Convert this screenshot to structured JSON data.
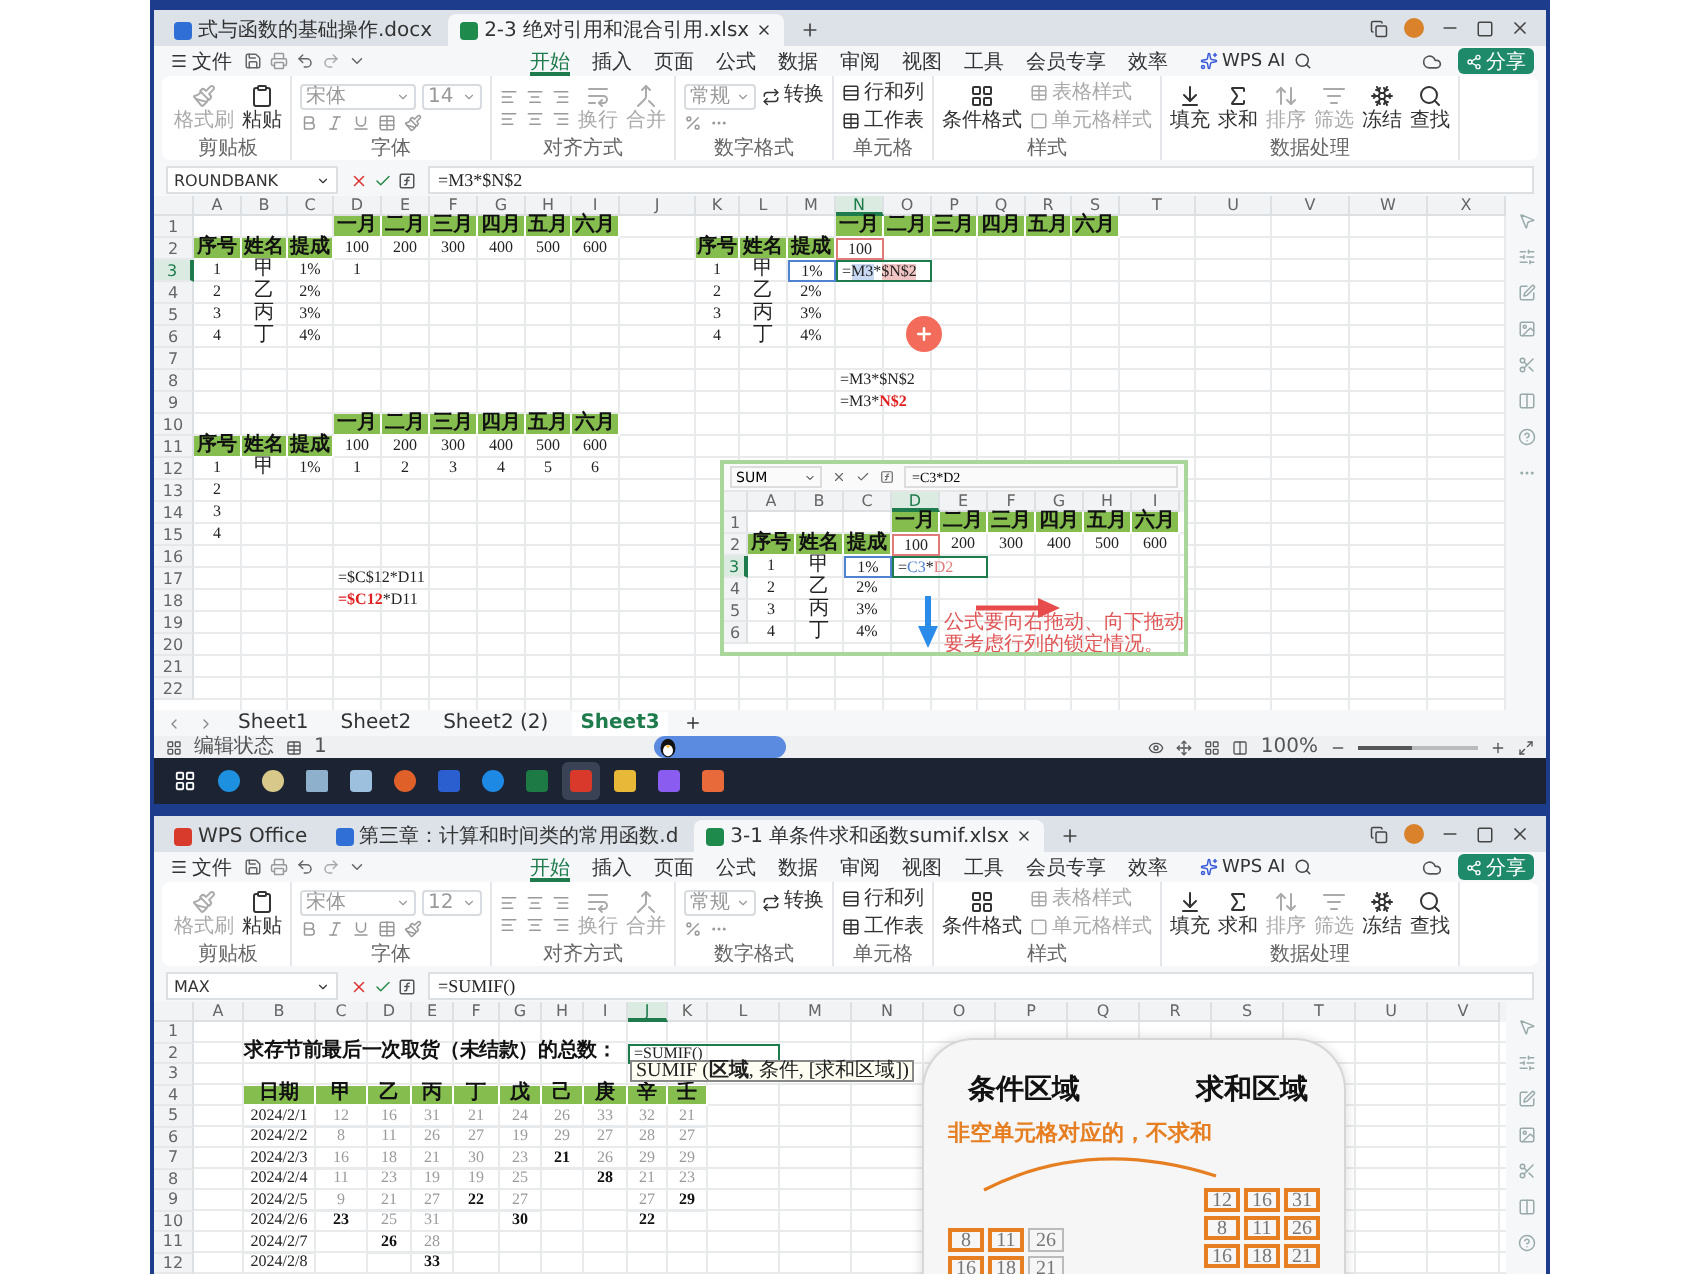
{
  "top": {
    "tabs": [
      {
        "label": "式与函数的基础操作.docx",
        "kind": "doc",
        "selected": false
      },
      {
        "label": "2-3 绝对引用和混合引用.xlsx",
        "kind": "sheet",
        "selected": true
      }
    ],
    "menu": {
      "file": "文件",
      "items": [
        {
          "label": "开始",
          "selected": true
        },
        {
          "label": "插入",
          "selected": false
        },
        {
          "label": "页面",
          "selected": false
        },
        {
          "label": "公式",
          "selected": false
        },
        {
          "label": "数据",
          "selected": false
        },
        {
          "label": "审阅",
          "selected": false
        },
        {
          "label": "视图",
          "selected": false
        },
        {
          "label": "工具",
          "selected": false
        },
        {
          "label": "会员专享",
          "selected": false
        },
        {
          "label": "效率",
          "selected": false
        }
      ],
      "ai": "WPS AI",
      "share": "分享"
    },
    "ribbon": {
      "groups": [
        {
          "kind": "clipboard",
          "label": "剪贴板",
          "items": [
            {
              "label": "格式刷",
              "disabled": true
            },
            {
              "label": "粘贴",
              "disabled": false
            }
          ]
        },
        {
          "kind": "font",
          "label": "字体",
          "font": "宋体",
          "size": "14"
        },
        {
          "kind": "align",
          "label": "对齐方式",
          "items": [
            {
              "label": "换行",
              "disabled": true
            },
            {
              "label": "合并",
              "disabled": true
            }
          ]
        },
        {
          "kind": "number",
          "label": "数字格式",
          "format": "常规",
          "items": [
            {
              "label": "转换",
              "disabled": false
            }
          ]
        },
        {
          "kind": "cells",
          "label": "单元格",
          "items": [
            {
              "label": "行和列",
              "disabled": false
            },
            {
              "label": "工作表",
              "disabled": false
            }
          ]
        },
        {
          "kind": "style",
          "label": "样式",
          "items": [
            {
              "label": "条件格式",
              "disabled": false
            },
            {
              "label": "表格样式",
              "disabled": true
            },
            {
              "label": "单元格样式",
              "disabled": true
            }
          ]
        },
        {
          "kind": "data",
          "label": "数据处理",
          "items": [
            {
              "label": "填充",
              "disabled": false
            },
            {
              "label": "求和",
              "disabled": false
            },
            {
              "label": "排序",
              "disabled": true
            },
            {
              "label": "筛选",
              "disabled": true
            },
            {
              "label": "冻结",
              "disabled": false
            },
            {
              "label": "查找",
              "disabled": false
            }
          ]
        }
      ]
    },
    "sheet": {
      "name_box": "ROUNDBANK",
      "formula": "=M3*$N$2",
      "columns": [
        {
          "label": "A",
          "selected": false
        },
        {
          "label": "B",
          "selected": false
        },
        {
          "label": "C",
          "selected": false
        },
        {
          "label": "D",
          "selected": false
        },
        {
          "label": "E",
          "selected": false
        },
        {
          "label": "F",
          "selected": false
        },
        {
          "label": "G",
          "selected": false
        },
        {
          "label": "H",
          "selected": false
        },
        {
          "label": "I",
          "selected": false
        },
        {
          "label": "J",
          "selected": false
        },
        {
          "label": "K",
          "selected": false
        },
        {
          "label": "L",
          "selected": false
        },
        {
          "label": "M",
          "selected": false
        },
        {
          "label": "N",
          "selected": true
        },
        {
          "label": "O",
          "selected": false
        },
        {
          "label": "P",
          "selected": false
        },
        {
          "label": "Q",
          "selected": false
        },
        {
          "label": "R",
          "selected": false
        },
        {
          "label": "S",
          "selected": false
        },
        {
          "label": "T",
          "selected": false
        },
        {
          "label": "U",
          "selected": false
        },
        {
          "label": "V",
          "selected": false
        },
        {
          "label": "W",
          "selected": false
        },
        {
          "label": "X",
          "selected": false
        }
      ],
      "rows": [
        {
          "number": "1",
          "selected": false,
          "cells": [
            null,
            null,
            null,
            {
              "text": "一月",
              "kind": "header"
            },
            {
              "text": "二月",
              "kind": "header"
            },
            {
              "text": "三月",
              "kind": "header"
            },
            {
              "text": "四月",
              "kind": "header"
            },
            {
              "text": "五月",
              "kind": "header"
            },
            {
              "text": "六月",
              "kind": "header"
            },
            null,
            null,
            null,
            null,
            {
              "text": "一月",
              "kind": "header"
            },
            {
              "text": "二月",
              "kind": "header"
            },
            {
              "text": "三月",
              "kind": "header"
            },
            {
              "text": "四月",
              "kind": "header"
            },
            {
              "text": "五月",
              "kind": "header"
            },
            {
              "text": "六月",
              "kind": "header"
            }
          ]
        },
        {
          "number": "2",
          "selected": false,
          "cells": [
            {
              "text": "序号",
              "kind": "header"
            },
            {
              "text": "姓名",
              "kind": "header"
            },
            {
              "text": "提成",
              "kind": "header"
            },
            {
              "text": "100",
              "kind": "number"
            },
            {
              "text": "200",
              "kind": "number"
            },
            {
              "text": "300",
              "kind": "number"
            },
            {
              "text": "400",
              "kind": "number"
            },
            {
              "text": "500",
              "kind": "number"
            },
            {
              "text": "600",
              "kind": "number"
            },
            null,
            {
              "text": "序号",
              "kind": "header"
            },
            {
              "text": "姓名",
              "kind": "header"
            },
            {
              "text": "提成",
              "kind": "header"
            },
            {
              "text": "100",
              "kind": "number",
              "color": "#e07b7b"
            }
          ]
        },
        {
          "number": "3",
          "selected": true,
          "cells": [
            {
              "text": "1",
              "kind": "number"
            },
            {
              "text": "甲",
              "kind": "label"
            },
            {
              "text": "1%",
              "kind": "number"
            },
            {
              "text": "1",
              "kind": "number"
            },
            null,
            null,
            null,
            null,
            null,
            null,
            {
              "text": "1",
              "kind": "number"
            },
            {
              "text": "甲",
              "kind": "label"
            },
            {
              "text": "1%",
              "kind": "number",
              "color": "#4f83d1"
            },
            {
              "kind": "formula",
              "active": true,
              "parts": [
                {
                  "text": "=",
                  "kind": "plain"
                },
                {
                  "text": "M3",
                  "kind": "mark",
                  "color": "#c9d8f3"
                },
                {
                  "text": "*",
                  "kind": "plain"
                },
                {
                  "text": "$N$2",
                  "kind": "mark",
                  "color": "#f2c5c5"
                }
              ]
            }
          ]
        },
        {
          "number": "4",
          "selected": false,
          "cells": [
            {
              "text": "2",
              "kind": "number"
            },
            {
              "text": "乙",
              "kind": "label"
            },
            {
              "text": "2%",
              "kind": "number"
            },
            null,
            null,
            null,
            null,
            null,
            null,
            null,
            {
              "text": "2",
              "kind": "number"
            },
            {
              "text": "乙",
              "kind": "label"
            },
            {
              "text": "2%",
              "kind": "number"
            }
          ]
        },
        {
          "number": "5",
          "selected": false,
          "cells": [
            {
              "text": "3",
              "kind": "number"
            },
            {
              "text": "丙",
              "kind": "label"
            },
            {
              "text": "3%",
              "kind": "number"
            },
            null,
            null,
            null,
            null,
            null,
            null,
            null,
            {
              "text": "3",
              "kind": "number"
            },
            {
              "text": "丙",
              "kind": "label"
            },
            {
              "text": "3%",
              "kind": "number"
            }
          ]
        },
        {
          "number": "6",
          "selected": false,
          "cells": [
            {
              "text": "4",
              "kind": "number"
            },
            {
              "text": "丁",
              "kind": "label"
            },
            {
              "text": "4%",
              "kind": "number"
            },
            null,
            null,
            null,
            null,
            null,
            null,
            null,
            {
              "text": "4",
              "kind": "number"
            },
            {
              "text": "丁",
              "kind": "label"
            },
            {
              "text": "4%",
              "kind": "number"
            }
          ]
        },
        {
          "number": "7",
          "selected": false
        },
        {
          "number": "8",
          "selected": false,
          "cells": [
            null,
            null,
            null,
            null,
            null,
            null,
            null,
            null,
            null,
            null,
            null,
            null,
            null,
            {
              "text": "=M3*$N$2",
              "kind": "formula"
            }
          ]
        },
        {
          "number": "9",
          "selected": false,
          "cells": [
            null,
            null,
            null,
            null,
            null,
            null,
            null,
            null,
            null,
            null,
            null,
            null,
            null,
            {
              "kind": "formula",
              "parts": [
                {
                  "text": "=M3*",
                  "kind": "plain"
                },
                {
                  "text": "N$2",
                  "kind": "emphasis"
                }
              ]
            }
          ]
        },
        {
          "number": "10",
          "selected": false,
          "cells": [
            null,
            null,
            null,
            {
              "text": "一月",
              "kind": "header"
            },
            {
              "text": "二月",
              "kind": "header"
            },
            {
              "text": "三月",
              "kind": "header"
            },
            {
              "text": "四月",
              "kind": "header"
            },
            {
              "text": "五月",
              "kind": "header"
            },
            {
              "text": "六月",
              "kind": "header"
            }
          ]
        },
        {
          "number": "11",
          "selected": false,
          "cells": [
            {
              "text": "序号",
              "kind": "header"
            },
            {
              "text": "姓名",
              "kind": "header"
            },
            {
              "text": "提成",
              "kind": "header"
            },
            {
              "text": "100",
              "kind": "number"
            },
            {
              "text": "200",
              "kind": "number"
            },
            {
              "text": "300",
              "kind": "number"
            },
            {
              "text": "400",
              "kind": "number"
            },
            {
              "text": "500",
              "kind": "number"
            },
            {
              "text": "600",
              "kind": "number"
            }
          ]
        },
        {
          "number": "12",
          "selected": false,
          "cells": [
            {
              "text": "1",
              "kind": "number"
            },
            {
              "text": "甲",
              "kind": "label"
            },
            {
              "text": "1%",
              "kind": "number"
            },
            {
              "text": "1",
              "kind": "number"
            },
            {
              "text": "2",
              "kind": "number"
            },
            {
              "text": "3",
              "kind": "number"
            },
            {
              "text": "4",
              "kind": "number"
            },
            {
              "text": "5",
              "kind": "number"
            },
            {
              "text": "6",
              "kind": "number"
            }
          ]
        },
        {
          "number": "13",
          "selected": false,
          "cells": [
            {
              "text": "2",
              "kind": "number"
            }
          ]
        },
        {
          "number": "14",
          "selected": false,
          "cells": [
            {
              "text": "3",
              "kind": "number"
            }
          ]
        },
        {
          "number": "15",
          "selected": false,
          "cells": [
            {
              "text": "4",
              "kind": "number"
            }
          ]
        },
        {
          "number": "16",
          "selected": false
        },
        {
          "number": "17",
          "selected": false,
          "cells": [
            null,
            null,
            null,
            {
              "text": "=$C$12*D11",
              "kind": "formula"
            }
          ]
        },
        {
          "number": "18",
          "selected": false,
          "cells": [
            null,
            null,
            null,
            {
              "kind": "formula",
              "parts": [
                {
                  "text": "=$C12",
                  "kind": "emphasis"
                },
                {
                  "text": "*D11",
                  "kind": "plain"
                }
              ]
            }
          ]
        },
        {
          "number": "19",
          "selected": false
        },
        {
          "number": "20",
          "selected": false
        },
        {
          "number": "21",
          "selected": false
        },
        {
          "number": "22",
          "selected": false
        }
      ]
    },
    "inset": {
      "name_box": "SUM",
      "formula": "=C3*D2",
      "columns": [
        {
          "label": "A",
          "selected": false
        },
        {
          "label": "B",
          "selected": false
        },
        {
          "label": "C",
          "selected": false
        },
        {
          "label": "D",
          "selected": true
        },
        {
          "label": "E",
          "selected": false
        },
        {
          "label": "F",
          "selected": false
        },
        {
          "label": "G",
          "selected": false
        },
        {
          "label": "H",
          "selected": false
        },
        {
          "label": "I",
          "selected": false
        }
      ],
      "rows": [
        {
          "number": "1",
          "selected": false,
          "cells": [
            null,
            null,
            null,
            {
              "text": "一月",
              "kind": "header"
            },
            {
              "text": "二月",
              "kind": "header"
            },
            {
              "text": "三月",
              "kind": "header"
            },
            {
              "text": "四月",
              "kind": "header"
            },
            {
              "text": "五月",
              "kind": "header"
            },
            {
              "text": "六月",
              "kind": "header"
            }
          ]
        },
        {
          "number": "2",
          "selected": false,
          "cells": [
            {
              "text": "序号",
              "kind": "header"
            },
            {
              "text": "姓名",
              "kind": "header"
            },
            {
              "text": "提成",
              "kind": "header"
            },
            {
              "text": "100",
              "kind": "number",
              "color": "#e07b7b"
            },
            {
              "text": "200",
              "kind": "number"
            },
            {
              "text": "300",
              "kind": "number"
            },
            {
              "text": "400",
              "kind": "number"
            },
            {
              "text": "500",
              "kind": "number"
            },
            {
              "text": "600",
              "kind": "number"
            }
          ]
        },
        {
          "number": "3",
          "selected": true,
          "cells": [
            {
              "text": "1",
              "kind": "number"
            },
            {
              "text": "甲",
              "kind": "label"
            },
            {
              "text": "1%",
              "kind": "number",
              "color": "#4f83d1"
            },
            {
              "kind": "formula",
              "active": true,
              "parts": [
                {
                  "text": "=",
                  "kind": "plain"
                },
                {
                  "text": "C3",
                  "kind": "ink",
                  "color": "#4f83d1"
                },
                {
                  "text": "*",
                  "kind": "plain"
                },
                {
                  "text": "D2",
                  "kind": "ink",
                  "color": "#e07b7b"
                }
              ]
            }
          ]
        },
        {
          "number": "4",
          "selected": false,
          "cells": [
            {
              "text": "2",
              "kind": "number"
            },
            {
              "text": "乙",
              "kind": "label"
            },
            {
              "text": "2%",
              "kind": "number"
            }
          ]
        },
        {
          "number": "5",
          "selected": false,
          "cells": [
            {
              "text": "3",
              "kind": "number"
            },
            {
              "text": "丙",
              "kind": "label"
            },
            {
              "text": "3%",
              "kind": "number"
            }
          ]
        },
        {
          "number": "6",
          "selected": false,
          "cells": [
            {
              "text": "4",
              "kind": "number"
            },
            {
              "text": "丁",
              "kind": "label"
            },
            {
              "text": "4%",
              "kind": "number"
            }
          ]
        }
      ],
      "note": "公式要向右拖动、向下拖动要考虑行列的锁定情况。"
    },
    "sheet_tabs": [
      {
        "label": "Sheet1",
        "selected": false
      },
      {
        "label": "Sheet2",
        "selected": false
      },
      {
        "label": "Sheet2 (2)",
        "selected": false
      },
      {
        "label": "Sheet3",
        "selected": true
      }
    ],
    "status": {
      "mode": "编辑状态",
      "page": "1",
      "zoom": "100%",
      "zoom_slider": {
        "level": 0.45
      }
    }
  },
  "bottom": {
    "tabs": [
      {
        "label": "WPS Office",
        "kind": "home",
        "selected": false
      },
      {
        "label": "第三章：计算和时间类的常用函数.d",
        "kind": "doc",
        "selected": false
      },
      {
        "label": "3-1 单条件求和函数sumif.xlsx",
        "kind": "sheet",
        "selected": true
      }
    ],
    "menu": {
      "file": "文件",
      "items": [
        {
          "label": "开始",
          "selected": true
        },
        {
          "label": "插入",
          "selected": false
        },
        {
          "label": "页面",
          "selected": false
        },
        {
          "label": "公式",
          "selected": false
        },
        {
          "label": "数据",
          "selected": false
        },
        {
          "label": "审阅",
          "selected": false
        },
        {
          "label": "视图",
          "selected": false
        },
        {
          "label": "工具",
          "selected": false
        },
        {
          "label": "会员专享",
          "selected": false
        },
        {
          "label": "效率",
          "selected": false
        }
      ],
      "ai": "WPS AI",
      "share": "分享"
    },
    "ribbon": {
      "groups": [
        {
          "kind": "clipboard",
          "label": "剪贴板",
          "items": [
            {
              "label": "格式刷",
              "disabled": true
            },
            {
              "label": "粘贴",
              "disabled": false
            }
          ]
        },
        {
          "kind": "font",
          "label": "字体",
          "font": "宋体",
          "size": "12"
        },
        {
          "kind": "align",
          "label": "对齐方式",
          "items": [
            {
              "label": "换行",
              "disabled": true
            },
            {
              "label": "合并",
              "disabled": true
            }
          ]
        },
        {
          "kind": "number",
          "label": "数字格式",
          "format": "常规",
          "items": [
            {
              "label": "转换",
              "disabled": false
            }
          ]
        },
        {
          "kind": "cells",
          "label": "单元格",
          "items": [
            {
              "label": "行和列",
              "disabled": false
            },
            {
              "label": "工作表",
              "disabled": false
            }
          ]
        },
        {
          "kind": "style",
          "label": "样式",
          "items": [
            {
              "label": "条件格式",
              "disabled": false
            },
            {
              "label": "表格样式",
              "disabled": true
            },
            {
              "label": "单元格样式",
              "disabled": true
            }
          ]
        },
        {
          "kind": "data",
          "label": "数据处理",
          "items": [
            {
              "label": "填充",
              "disabled": false
            },
            {
              "label": "求和",
              "disabled": false
            },
            {
              "label": "排序",
              "disabled": true
            },
            {
              "label": "筛选",
              "disabled": true
            },
            {
              "label": "冻结",
              "disabled": false
            },
            {
              "label": "查找",
              "disabled": false
            }
          ]
        }
      ]
    },
    "sheet": {
      "name_box": "MAX",
      "formula": "=SUMIF()",
      "columns": [
        {
          "label": "A",
          "selected": false
        },
        {
          "label": "B",
          "selected": false
        },
        {
          "label": "C",
          "selected": false
        },
        {
          "label": "D",
          "selected": false
        },
        {
          "label": "E",
          "selected": false
        },
        {
          "label": "F",
          "selected": false
        },
        {
          "label": "G",
          "selected": false
        },
        {
          "label": "H",
          "selected": false
        },
        {
          "label": "I",
          "selected": false
        },
        {
          "label": "J",
          "selected": true
        },
        {
          "label": "K",
          "selected": false
        },
        {
          "label": "L",
          "selected": false
        },
        {
          "label": "M",
          "selected": false
        },
        {
          "label": "N",
          "selected": false
        },
        {
          "label": "O",
          "selected": false
        },
        {
          "label": "P",
          "selected": false
        },
        {
          "label": "Q",
          "selected": false
        },
        {
          "label": "R",
          "selected": false
        },
        {
          "label": "S",
          "selected": false
        },
        {
          "label": "T",
          "selected": false
        },
        {
          "label": "U",
          "selected": false
        },
        {
          "label": "V",
          "selected": false
        }
      ],
      "rows": [
        {
          "number": "1",
          "selected": false
        },
        {
          "number": "2",
          "selected": false,
          "cells": [
            null,
            {
              "text": "求存节前最后一次取货（未结款）的总数：",
              "kind": "title"
            },
            null,
            null,
            null,
            null,
            null,
            null,
            null,
            {
              "text": "=SUMIF()",
              "kind": "formula",
              "active": true
            }
          ]
        },
        {
          "number": "3",
          "selected": false
        },
        {
          "number": "4",
          "selected": false,
          "cells": [
            null,
            {
              "text": "日期",
              "kind": "header"
            },
            {
              "text": "甲",
              "kind": "header"
            },
            {
              "text": "乙",
              "kind": "header"
            },
            {
              "text": "丙",
              "kind": "header"
            },
            {
              "text": "丁",
              "kind": "header"
            },
            {
              "text": "戊",
              "kind": "header"
            },
            {
              "text": "己",
              "kind": "header"
            },
            {
              "text": "庚",
              "kind": "header"
            },
            {
              "text": "辛",
              "kind": "header"
            },
            {
              "text": "壬",
              "kind": "header"
            }
          ]
        },
        {
          "number": "5",
          "selected": false,
          "cells": [
            null,
            {
              "text": "2024/2/1",
              "kind": "number"
            },
            {
              "text": "12",
              "kind": "dim"
            },
            {
              "text": "16",
              "kind": "dim"
            },
            {
              "text": "31",
              "kind": "dim"
            },
            {
              "text": "21",
              "kind": "dim"
            },
            {
              "text": "24",
              "kind": "dim"
            },
            {
              "text": "26",
              "kind": "dim"
            },
            {
              "text": "33",
              "kind": "dim"
            },
            {
              "text": "32",
              "kind": "dim"
            },
            {
              "text": "21",
              "kind": "dim"
            }
          ]
        },
        {
          "number": "6",
          "selected": false,
          "cells": [
            null,
            {
              "text": "2024/2/2",
              "kind": "number"
            },
            {
              "text": "8",
              "kind": "dim"
            },
            {
              "text": "11",
              "kind": "dim"
            },
            {
              "text": "26",
              "kind": "dim"
            },
            {
              "text": "27",
              "kind": "dim"
            },
            {
              "text": "19",
              "kind": "dim"
            },
            {
              "text": "29",
              "kind": "dim"
            },
            {
              "text": "27",
              "kind": "dim"
            },
            {
              "text": "28",
              "kind": "dim"
            },
            {
              "text": "27",
              "kind": "dim"
            }
          ]
        },
        {
          "number": "7",
          "selected": false,
          "cells": [
            null,
            {
              "text": "2024/2/3",
              "kind": "number"
            },
            {
              "text": "16",
              "kind": "dim"
            },
            {
              "text": "18",
              "kind": "dim"
            },
            {
              "text": "21",
              "kind": "dim"
            },
            {
              "text": "30",
              "kind": "dim"
            },
            {
              "text": "23",
              "kind": "dim"
            },
            {
              "text": "21",
              "kind": "bold"
            },
            {
              "text": "26",
              "kind": "dim"
            },
            {
              "text": "29",
              "kind": "dim"
            },
            {
              "text": "29",
              "kind": "dim"
            }
          ]
        },
        {
          "number": "8",
          "selected": false,
          "cells": [
            null,
            {
              "text": "2024/2/4",
              "kind": "number"
            },
            {
              "text": "11",
              "kind": "dim"
            },
            {
              "text": "23",
              "kind": "dim"
            },
            {
              "text": "19",
              "kind": "dim"
            },
            {
              "text": "19",
              "kind": "dim"
            },
            {
              "text": "25",
              "kind": "dim"
            },
            null,
            {
              "text": "28",
              "kind": "bold"
            },
            {
              "text": "21",
              "kind": "dim"
            },
            {
              "text": "23",
              "kind": "dim"
            }
          ]
        },
        {
          "number": "9",
          "selected": false,
          "cells": [
            null,
            {
              "text": "2024/2/5",
              "kind": "number"
            },
            {
              "text": "9",
              "kind": "dim"
            },
            {
              "text": "21",
              "kind": "dim"
            },
            {
              "text": "27",
              "kind": "dim"
            },
            {
              "text": "22",
              "kind": "bold"
            },
            {
              "text": "27",
              "kind": "dim"
            },
            null,
            null,
            {
              "text": "27",
              "kind": "dim"
            },
            {
              "text": "29",
              "kind": "bold"
            }
          ]
        },
        {
          "number": "10",
          "selected": false,
          "cells": [
            null,
            {
              "text": "2024/2/6",
              "kind": "number"
            },
            {
              "text": "23",
              "kind": "bold"
            },
            {
              "text": "25",
              "kind": "dim"
            },
            {
              "text": "31",
              "kind": "dim"
            },
            null,
            {
              "text": "30",
              "kind": "bold"
            },
            null,
            null,
            {
              "text": "22",
              "kind": "bold"
            }
          ]
        },
        {
          "number": "11",
          "selected": false,
          "cells": [
            null,
            {
              "text": "2024/2/7",
              "kind": "number"
            },
            null,
            {
              "text": "26",
              "kind": "bold"
            },
            {
              "text": "28",
              "kind": "dim"
            }
          ]
        },
        {
          "number": "12",
          "selected": false,
          "cells": [
            null,
            {
              "text": "2024/2/8",
              "kind": "number"
            },
            null,
            null,
            {
              "text": "33",
              "kind": "bold"
            }
          ]
        }
      ]
    },
    "tooltip": "SUMIF (**区域**, 条件, [求和区域])",
    "diagram": {
      "condition_title": "条件区域",
      "sum_title": "求和区域",
      "note": "非空单元格对应的，不求和",
      "condition_rows": [
        [
          {
            "text": "8",
            "boxed": true
          },
          {
            "text": "11",
            "boxed": true
          },
          {
            "text": "26",
            "boxed": false
          }
        ],
        [
          {
            "text": "16",
            "boxed": true
          },
          {
            "text": "18",
            "boxed": true
          },
          {
            "text": "21",
            "boxed": false
          }
        ]
      ],
      "sum_rows": [
        [
          {
            "text": "12",
            "boxed": true
          },
          {
            "text": "16",
            "boxed": true
          },
          {
            "text": "31",
            "boxed": true
          }
        ],
        [
          {
            "text": "8",
            "boxed": true
          },
          {
            "text": "11",
            "boxed": true
          },
          {
            "text": "26",
            "boxed": true
          }
        ],
        [
          {
            "text": "16",
            "boxed": true
          },
          {
            "text": "18",
            "boxed": true
          },
          {
            "text": "21",
            "boxed": true
          }
        ]
      ]
    }
  }
}
